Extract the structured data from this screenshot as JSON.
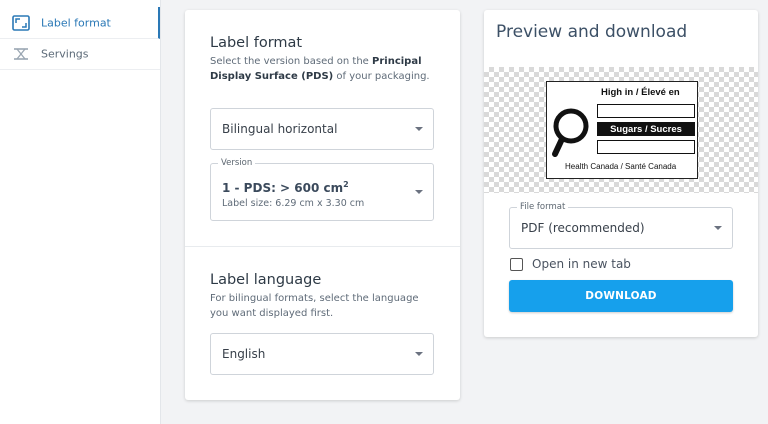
{
  "sidebar": {
    "items": [
      {
        "label": "Label format",
        "icon": "aspect-ratio-icon",
        "active": true
      },
      {
        "label": "Servings",
        "icon": "servings-icon",
        "active": false
      }
    ]
  },
  "label_format": {
    "title": "Label format",
    "desc_prefix": "Select the version based on the ",
    "desc_bold": "Principal Display Surface (PDS)",
    "desc_suffix": " of your packaging.",
    "format_select_value": "Bilingual horizontal",
    "version_legend": "Version",
    "version_main": "1 - PDS: > 600 cm",
    "version_sup": "2",
    "version_sub": "Label size: 6.29 cm x 3.30 cm"
  },
  "label_language": {
    "title": "Label language",
    "desc": "For bilingual formats, select the language you want displayed first.",
    "language_select_value": "English"
  },
  "preview": {
    "title": "Preview and download",
    "fop_line1": "High in / Élevé en",
    "fop_nutrient": "Sugars / Sucres",
    "fop_footer": "Health Canada / Santé Canada",
    "file_format_legend": "File format",
    "file_format_value": "PDF (recommended)",
    "open_new_tab_label": "Open in new tab",
    "download_label": "DOWNLOAD"
  },
  "colors": {
    "accent": "#2a78b6",
    "button": "#16a0ec",
    "background": "#f2f3f5"
  }
}
